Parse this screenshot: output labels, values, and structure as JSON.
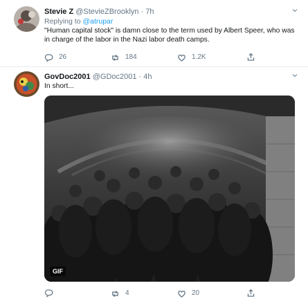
{
  "tweets": [
    {
      "name": "Stevie Z",
      "handle": "@StevieZBrooklyn",
      "time": "7h",
      "reply_prefix": "Replying to",
      "reply_to": "@atrupar",
      "text": "\"Human capital stock\" is damn close to the term used by Albert Speer, who was in charge of the labor in the Nazi labor death camps.",
      "replies": "26",
      "retweets": "184",
      "likes": "1.2K"
    },
    {
      "name": "GovDoc2001",
      "handle": "@GDoc2001",
      "time": "4h",
      "text": "In short...",
      "media_badge": "GIF",
      "replies": "",
      "retweets": "4",
      "likes": "20"
    }
  ],
  "separator": "·",
  "icons": [
    "reply-icon",
    "retweet-icon",
    "like-icon",
    "share-icon",
    "chevron-down-icon"
  ],
  "colors": {
    "link": "#1da1f2",
    "secondary": "#657786",
    "border": "#e6ecf0"
  }
}
